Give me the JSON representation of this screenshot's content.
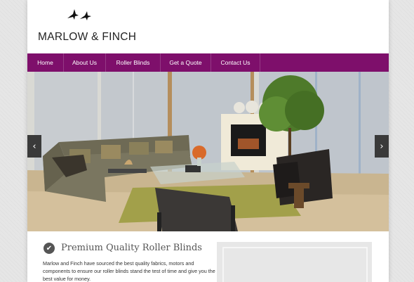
{
  "brand": {
    "name": "MARLOW & FINCH",
    "logo_icon": "birds-logo-icon"
  },
  "nav": {
    "items": [
      {
        "label": "Home"
      },
      {
        "label": "About Us"
      },
      {
        "label": "Roller Blinds"
      },
      {
        "label": "Get a Quote"
      },
      {
        "label": "Contact Us"
      }
    ]
  },
  "slider": {
    "prev_icon": "‹",
    "next_icon": "›"
  },
  "feature": {
    "icon": "✔",
    "heading": "Premium Quality Roller Blinds",
    "text": "Marlow and Finch have sourced the best quality fabrics, motors and components to ensure our roller blinds stand the test of time and give you the best value for money."
  },
  "colors": {
    "nav_bg": "#7e0f6b",
    "page_bg": "#ffffff",
    "body_bg": "#e6e6e6"
  }
}
